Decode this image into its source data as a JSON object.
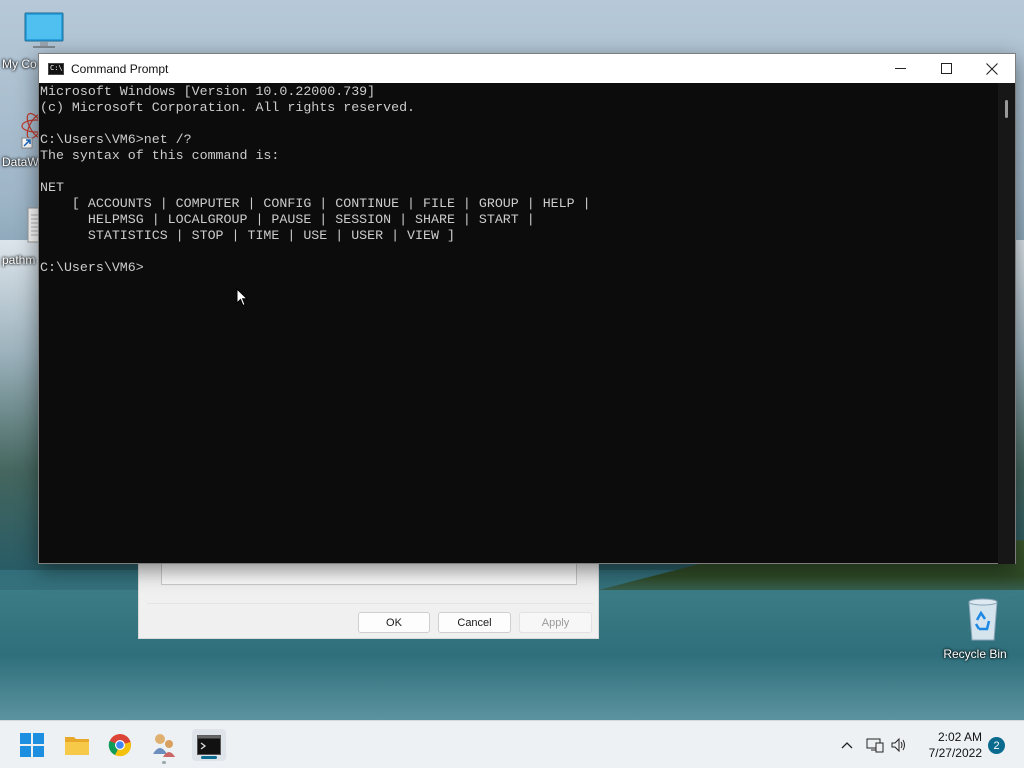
{
  "desktop": {
    "icons": [
      {
        "label": "My Co",
        "icon": "computer-icon"
      },
      {
        "label": "DataW",
        "icon": "datawrapper-shortcut-icon"
      },
      {
        "label": "pathm",
        "icon": "document-icon"
      },
      {
        "label": "Recycle Bin",
        "icon": "recycle-bin-icon"
      }
    ]
  },
  "background_dialog": {
    "ok_label": "OK",
    "cancel_label": "Cancel",
    "apply_label": "Apply"
  },
  "cmd": {
    "title": "Command Prompt",
    "icon_text": "C:\\",
    "lines": [
      "Microsoft Windows [Version 10.0.22000.739]",
      "(c) Microsoft Corporation. All rights reserved.",
      "",
      "C:\\Users\\VM6>net /?",
      "The syntax of this command is:",
      "",
      "NET",
      "    [ ACCOUNTS | COMPUTER | CONFIG | CONTINUE | FILE | GROUP | HELP |",
      "      HELPMSG | LOCALGROUP | PAUSE | SESSION | SHARE | START |",
      "      STATISTICS | STOP | TIME | USE | USER | VIEW ]",
      "",
      "C:\\Users\\VM6>"
    ]
  },
  "taskbar": {
    "apps": [
      "start-icon",
      "file-explorer-icon",
      "chrome-icon",
      "user-accounts-icon",
      "command-prompt-icon"
    ],
    "clock_time": "2:02 AM",
    "clock_date": "7/27/2022",
    "notification_count": "2"
  },
  "colors": {
    "console_bg": "#0c0c0c",
    "console_fg": "#cccccc",
    "accent": "#0a6b8f"
  }
}
